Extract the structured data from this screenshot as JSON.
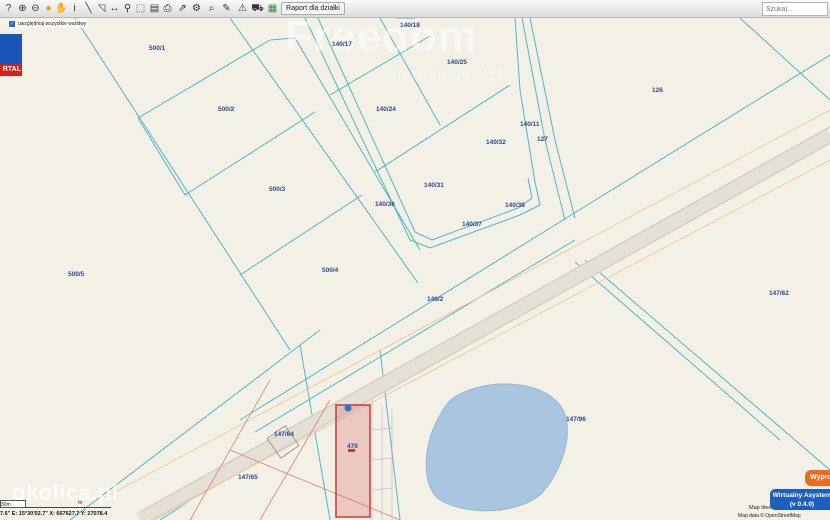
{
  "toolbar": {
    "report_button": "Raport dla działki",
    "search_placeholder": "Szukaj...",
    "tools": [
      {
        "icon": "info-icon",
        "glyph": "?"
      },
      {
        "icon": "zoom-in-icon",
        "glyph": "⊕"
      },
      {
        "icon": "zoom-out-icon",
        "glyph": "⊖"
      },
      {
        "icon": "full-extent-icon",
        "glyph": "●"
      },
      {
        "icon": "pan-icon",
        "glyph": "✋"
      },
      {
        "icon": "identify-icon",
        "glyph": "i"
      },
      {
        "icon": "measure-line-icon",
        "glyph": "╲"
      },
      {
        "icon": "measure-area-icon",
        "glyph": "◹"
      },
      {
        "icon": "measure-distance-icon",
        "glyph": "↔"
      },
      {
        "icon": "location-pin-icon",
        "glyph": "⚲"
      },
      {
        "icon": "select-icon",
        "glyph": "⬚"
      },
      {
        "icon": "layers-icon",
        "glyph": "▤"
      },
      {
        "icon": "print-icon",
        "glyph": "⎙"
      },
      {
        "icon": "share-icon",
        "glyph": "⇗"
      },
      {
        "icon": "settings-icon",
        "glyph": "⚙"
      },
      {
        "icon": "search-map-icon",
        "glyph": "⌕"
      },
      {
        "icon": "draw-icon",
        "glyph": "✎"
      },
      {
        "icon": "warning-icon",
        "glyph": "⚠"
      },
      {
        "icon": "cart-icon",
        "glyph": "⛟"
      },
      {
        "icon": "legend-icon",
        "glyph": "▦"
      }
    ]
  },
  "overlay": {
    "checkbox_label": "uwzględniaj wszystkie warstwy",
    "checkbox_checked": true,
    "logo_text": "RTAL"
  },
  "watermark": {
    "title": "Freedom",
    "subtitle": "nieruchomości"
  },
  "parcels": [
    "500/1",
    "500/2",
    "500/3",
    "500/4",
    "500/5",
    "140/17",
    "140/18",
    "140/25",
    "140/24",
    "140/11",
    "127",
    "140/32",
    "126",
    "140/31",
    "140/36",
    "140/38",
    "140/37",
    "146/2",
    "147/62",
    "147/96",
    "147/64",
    "470",
    "147/65"
  ],
  "status": {
    "scale_label": "30m",
    "scale_unit": "m",
    "coordinates": "7.6\"  E: 15°30'02.7\"  X: 667627.7  Y: 27078.4",
    "watermark_corner": "okolica.pl"
  },
  "buttons": {
    "wyprowadz": "Wypro",
    "assistant_line1": "Wirtualny Asystent",
    "assistant_line2": "(v 0.4.0)"
  },
  "attribution": {
    "line1": "Map tiles",
    "line2": "Map data © OpenStreetMap"
  }
}
